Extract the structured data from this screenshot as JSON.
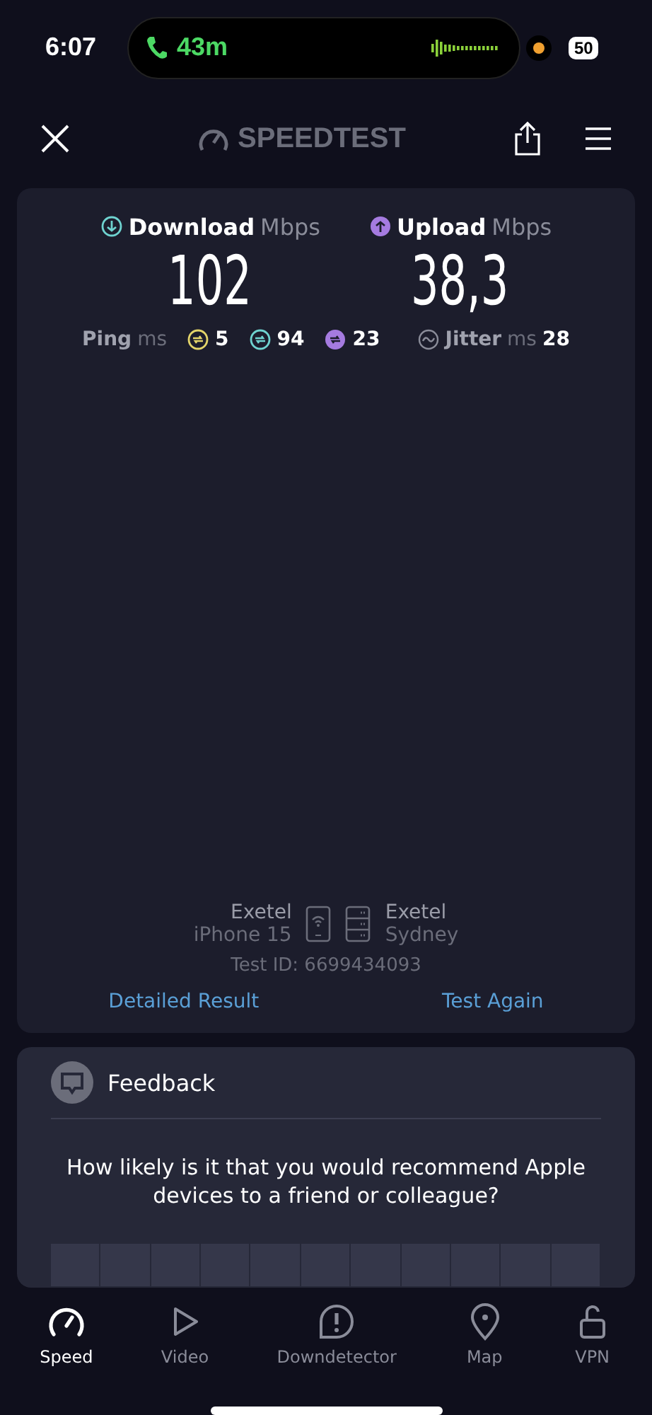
{
  "status_bar": {
    "time": "6:07",
    "call_duration": "43m",
    "battery": "50"
  },
  "header": {
    "logo_text": "SPEEDTEST"
  },
  "results": {
    "download": {
      "label": "Download",
      "unit": "Mbps",
      "value": "102"
    },
    "upload": {
      "label": "Upload",
      "unit": "Mbps",
      "value": "38,3"
    },
    "ping": {
      "label": "Ping",
      "unit": "ms",
      "values": [
        {
          "kind": "idle",
          "value": "5"
        },
        {
          "kind": "download",
          "value": "94"
        },
        {
          "kind": "upload",
          "value": "23"
        }
      ]
    },
    "jitter": {
      "label": "Jitter",
      "unit": "ms",
      "value": "28"
    }
  },
  "connection": {
    "provider": "Exetel",
    "device": "iPhone 15",
    "server_provider": "Exetel",
    "server_location": "Sydney",
    "test_id": "Test ID: 6699434093"
  },
  "links": [
    "Detailed Result",
    "Test Again"
  ],
  "feedback": {
    "title": "Feedback",
    "question": "How likely is it that you would recommend Apple devices to a friend or colleague?"
  },
  "tabs": [
    {
      "kind": "speed",
      "label": "Speed",
      "selected": true
    },
    {
      "kind": "video",
      "label": "Video",
      "selected": false
    },
    {
      "kind": "downdetector",
      "label": "Downdetector",
      "selected": false
    },
    {
      "kind": "map",
      "label": "Map",
      "selected": false
    },
    {
      "kind": "vpn",
      "label": "VPN",
      "selected": false
    }
  ]
}
